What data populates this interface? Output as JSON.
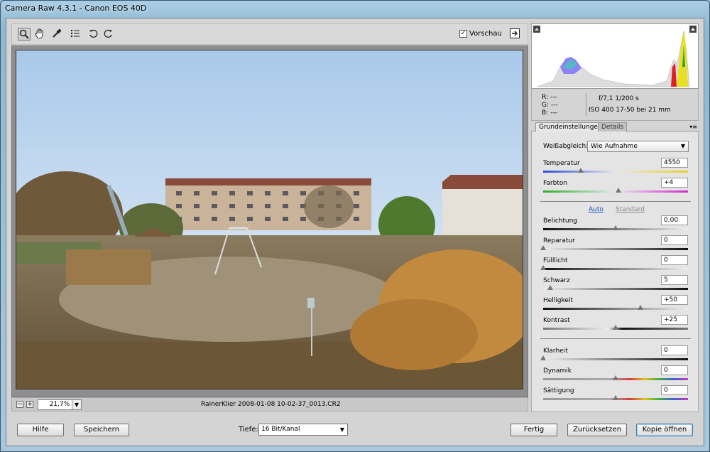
{
  "window": {
    "title": "Camera Raw 4.3.1 - Canon EOS 40D"
  },
  "toolbar": {
    "tools": [
      {
        "name": "zoom-tool-icon",
        "glyph": "🔍︎"
      },
      {
        "name": "hand-tool-icon",
        "glyph": "✋︎"
      },
      {
        "name": "eyedropper-tool-icon",
        "glyph": "✎"
      },
      {
        "name": "color-sampler-icon",
        "glyph": "☰"
      },
      {
        "name": "rotate-left-icon",
        "glyph": "↺"
      },
      {
        "name": "rotate-right-icon",
        "glyph": "↻"
      }
    ],
    "preview_label": "Vorschau",
    "preview_checked": true
  },
  "status": {
    "zoom": "21,7%",
    "filename": "RainerKlier 2008-01-08 10-02-37_0013.CR2"
  },
  "info": {
    "r": "R:   ---",
    "g": "G:   ---",
    "b": "B:   ---",
    "exif_line1": "f/7,1     1/200 s",
    "exif_line2": "ISO 400     17-50 bei 21 mm"
  },
  "tabs": [
    "Grundeinstellungen",
    "Details"
  ],
  "settings": {
    "wb_label": "Weißabgleich:",
    "wb_value": "Wie Aufnahme",
    "auto": "Auto",
    "standard": "Standard",
    "sliders": [
      {
        "label": "Temperatur",
        "value": "4550",
        "pos": 0.26
      },
      {
        "label": "Farbton",
        "value": "+4",
        "pos": 0.52
      },
      {
        "label": "Belichtung",
        "value": "0,00",
        "pos": 0.5
      },
      {
        "label": "Reparatur",
        "value": "0",
        "pos": 0.0
      },
      {
        "label": "Fülllicht",
        "value": "0",
        "pos": 0.0
      },
      {
        "label": "Schwarz",
        "value": "5",
        "pos": 0.05
      },
      {
        "label": "Helligkeit",
        "value": "+50",
        "pos": 0.67
      },
      {
        "label": "Kontrast",
        "value": "+25",
        "pos": 0.5
      },
      {
        "label": "Klarheit",
        "value": "0",
        "pos": 0.0
      },
      {
        "label": "Dynamik",
        "value": "0",
        "pos": 0.5
      },
      {
        "label": "Sättigung",
        "value": "0",
        "pos": 0.5
      }
    ]
  },
  "bottom": {
    "help": "Hilfe",
    "save": "Speichern",
    "depth_label": "Tiefe:",
    "depth_value": "16 Bit/Kanal",
    "done": "Fertig",
    "reset": "Zurücksetzen",
    "open_copy": "Kopie öffnen"
  }
}
